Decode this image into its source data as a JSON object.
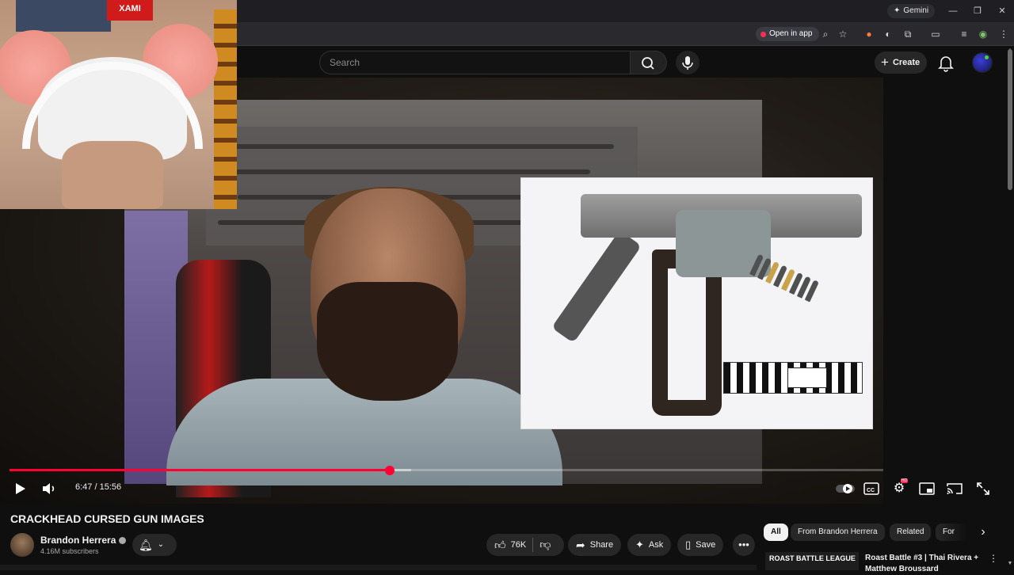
{
  "browser": {
    "gemini_label": "Gemini",
    "open_in_app_label": "Open in app"
  },
  "header": {
    "search_placeholder": "Search",
    "create_label": "Create"
  },
  "player": {
    "current_time": "6:47",
    "duration": "15:56",
    "time_separator": " / ",
    "progress_fraction": 0.435,
    "buffered_fraction": 0.46,
    "hd_badge": "HD"
  },
  "webcam": {
    "poster_text": "XAMI"
  },
  "video": {
    "title": "CRACKHEAD CURSED GUN IMAGES",
    "channel_name": "Brandon Herrera",
    "subscribers": "4.16M subscribers",
    "likes": "76K",
    "share_label": "Share",
    "ask_label": "Ask",
    "save_label": "Save"
  },
  "chips": [
    "All",
    "From Brandon Herrera",
    "Related",
    "For yo"
  ],
  "recommendation": {
    "thumb_text": "ROAST BATTLE LEAGUE",
    "title": "Roast Battle #3 | Thai Rivera + Matthew Broussard"
  },
  "colors": {
    "accent": "#ff0033",
    "background": "#0f0f0f",
    "pill": "#272727"
  }
}
